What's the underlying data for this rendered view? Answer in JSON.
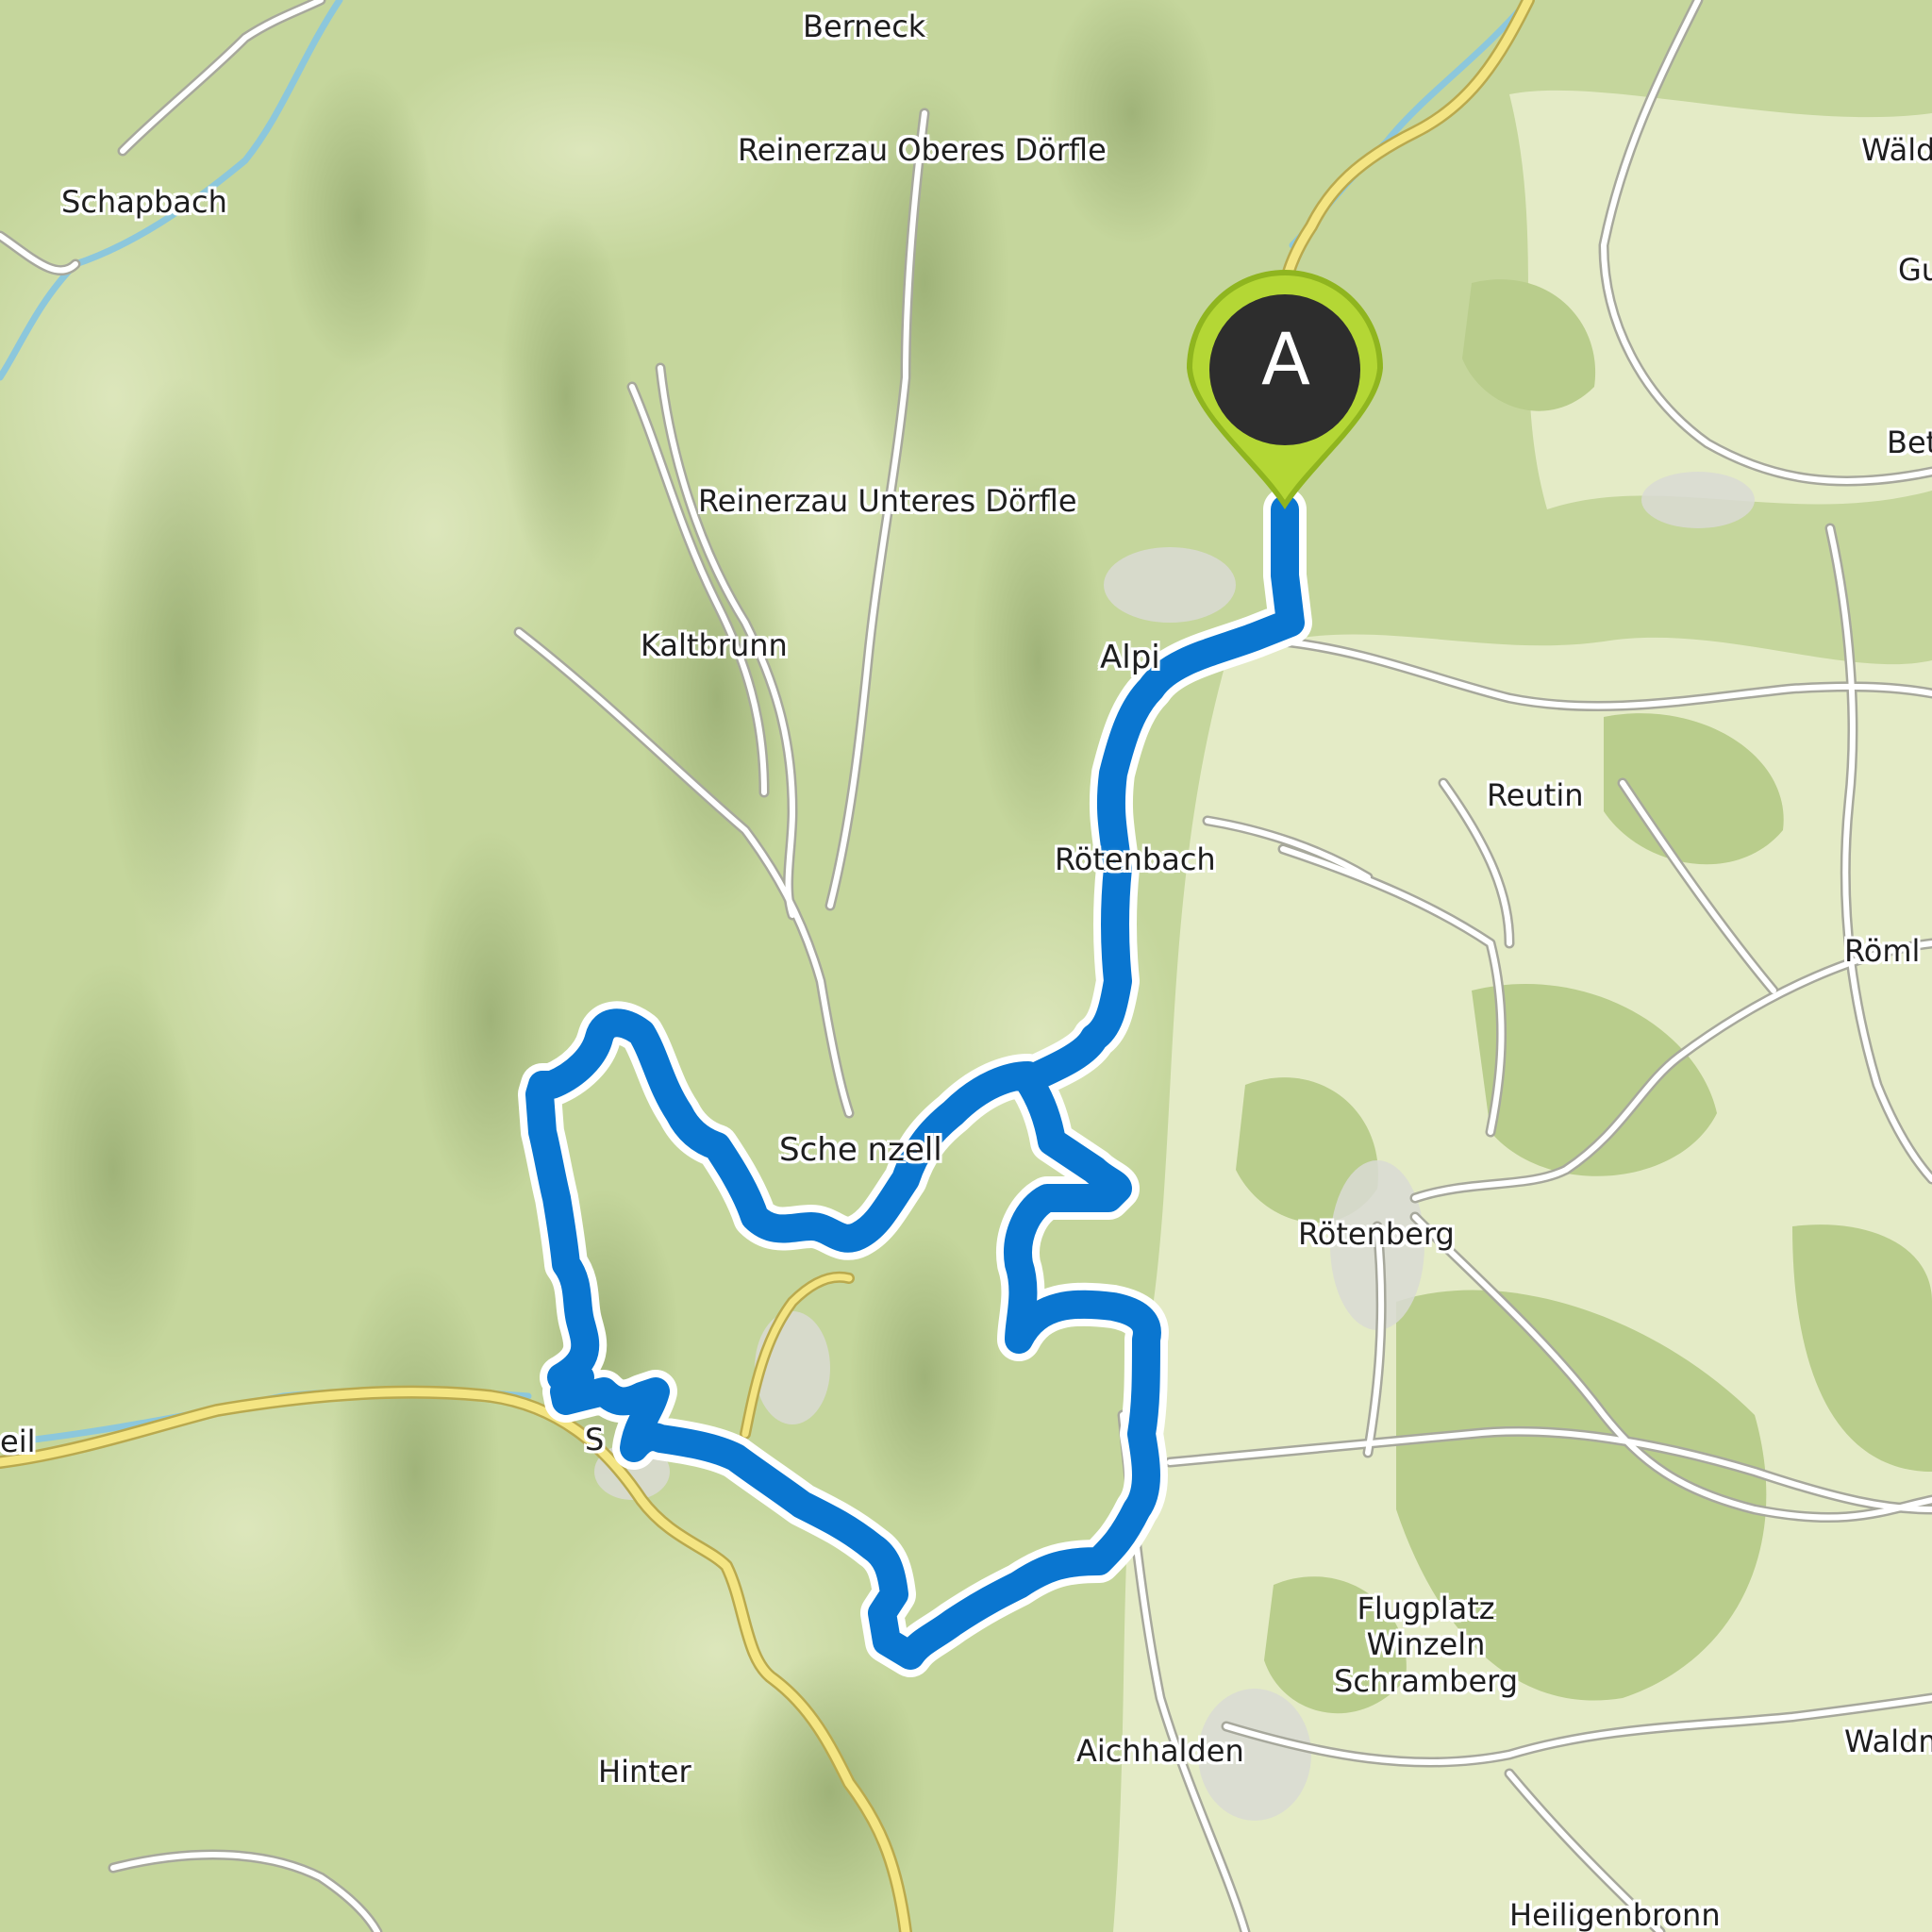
{
  "map": {
    "type": "topographic route map",
    "colors": {
      "terrain_base": "#c9d9a2",
      "terrain_light": "#dbe6b6",
      "forest_dark": "#aebf83",
      "route": "#0a76d0",
      "route_casing": "#ffffff",
      "main_road": "#f2e27a",
      "minor_road": "#ffffff",
      "river": "#8cc7dc",
      "marker_fill": "#a6ce2a",
      "marker_inner": "#2d2d2d"
    },
    "start_marker": {
      "letter": "A",
      "icon": "map-pin-icon"
    },
    "places": [
      {
        "key": "berneck",
        "name": "Berneck"
      },
      {
        "key": "reinerzau_oberes",
        "name": "Reinerzau Oberes Dörfle"
      },
      {
        "key": "schapbach",
        "name": "Schapbach"
      },
      {
        "key": "reinerzau_unteres",
        "name": "Reinerzau Unteres Dörfle"
      },
      {
        "key": "kaltbrunn",
        "name": "Kaltbrunn"
      },
      {
        "key": "alpirsbach",
        "name": "Alpi"
      },
      {
        "key": "reutin",
        "name": "Reutin"
      },
      {
        "key": "roetenbach",
        "name": "Rötenbach"
      },
      {
        "key": "schenkenzell",
        "name": "Sche nzell"
      },
      {
        "key": "roetenberg",
        "name": "Rötenberg"
      },
      {
        "key": "flugplatz",
        "name": "Flugplatz\nWinzeln\nSchramberg"
      },
      {
        "key": "aichhalden",
        "name": "Aichhalden"
      },
      {
        "key": "hinter",
        "name": "Hinter"
      },
      {
        "key": "heiligenbronn",
        "name": "Heiligenbronn"
      },
      {
        "key": "waeld",
        "name": "Wäld"
      },
      {
        "key": "betz",
        "name": "Betz"
      },
      {
        "key": "roeml",
        "name": "Röml"
      },
      {
        "key": "waldm",
        "name": "Waldm"
      },
      {
        "key": "gu",
        "name": "Gu"
      },
      {
        "key": "eil",
        "name": "eil"
      },
      {
        "key": "s_town",
        "name": "S"
      }
    ]
  }
}
